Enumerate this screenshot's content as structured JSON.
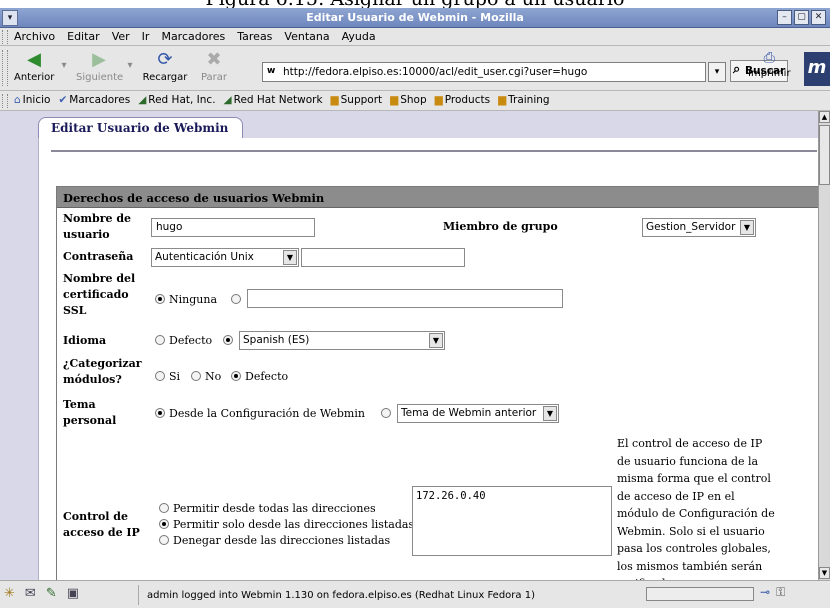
{
  "caption": "Figura 6.15: Asignar un grupo a un usuario",
  "window": {
    "title": "Editar Usuario de Webmin - Mozilla"
  },
  "menu": [
    "Archivo",
    "Editar",
    "Ver",
    "Ir",
    "Marcadores",
    "Tareas",
    "Ventana",
    "Ayuda"
  ],
  "nav": {
    "back": "Anterior",
    "forward": "Siguiente",
    "reload": "Recargar",
    "stop": "Parar",
    "url": "http://fedora.elpiso.es:10000/acl/edit_user.cgi?user=hugo",
    "search": "Buscar",
    "print": "Imprimir"
  },
  "bookmarks": [
    "Inicio",
    "Marcadores",
    "Red Hat, Inc.",
    "Red Hat Network",
    "Support",
    "Shop",
    "Products",
    "Training"
  ],
  "page": {
    "tab": "Editar Usuario de Webmin",
    "section_title": "Derechos de acceso de usuarios Webmin",
    "username_label": "Nombre de usuario",
    "username_value": "hugo",
    "group_label": "Miembro de grupo",
    "group_value": "Gestion_Servidor",
    "password_label": "Contraseña",
    "password_mode": "Autenticación Unix",
    "password_value": "",
    "ssl_label": "Nombre del certificado SSL",
    "ssl_option_none": "Ninguna",
    "ssl_value": "",
    "lang_label": "Idioma",
    "lang_default": "Defecto",
    "lang_value": "Spanish (ES)",
    "categorize_label": "¿Categorizar módulos?",
    "categorize_yes": "Si",
    "categorize_no": "No",
    "categorize_default": "Defecto",
    "theme_label": "Tema personal",
    "theme_option": "Desde la Configuración de Webmin",
    "theme_value": "Tema de Webmin anterior",
    "ip_label": "Control de acceso de IP",
    "ip_allow_all": "Permitir desde todas las direcciones",
    "ip_allow_listed": "Permitir solo desde las direcciones listadas",
    "ip_deny_listed": "Denegar desde las direcciones listadas",
    "ip_list": "172.26.0.40",
    "ip_help": "El control de acceso de IP de usuario funciona de la misma forma que el control de acceso de IP en el módulo de Configuración de Webmin. Solo si el usuario pasa los controles globales, los mismos también serán verificados"
  },
  "status": {
    "text": "admin logged into Webmin 1.130 on fedora.elpiso.es (Redhat Linux Fedora 1)"
  }
}
